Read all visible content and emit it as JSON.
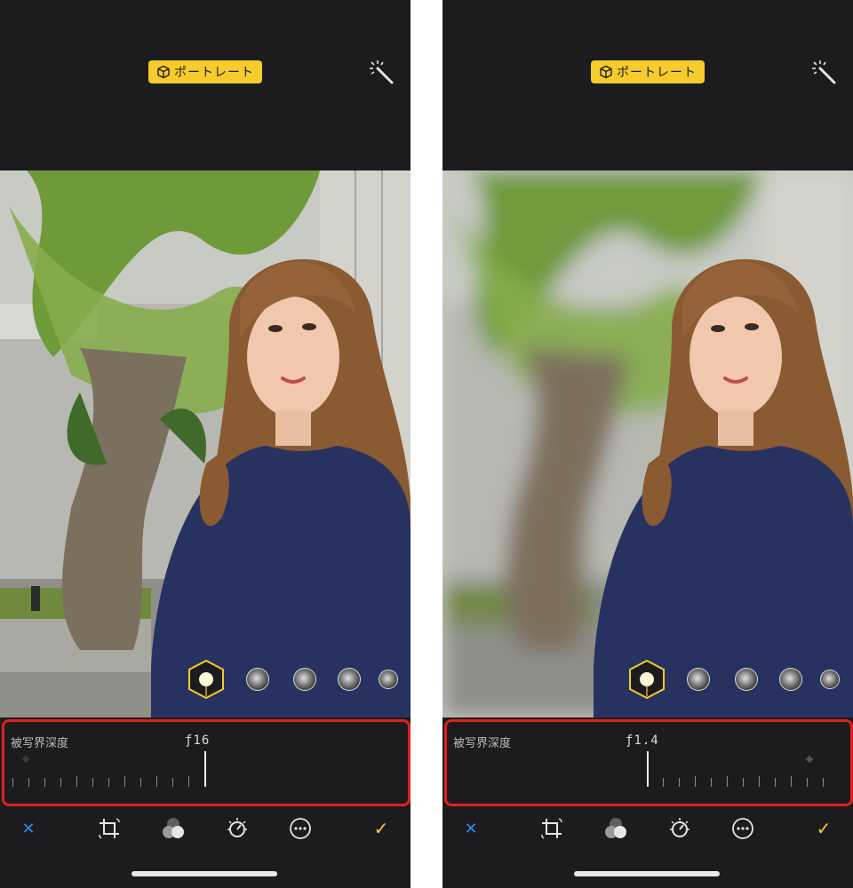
{
  "screens": [
    {
      "id": "left",
      "mode_badge": "ポートレート",
      "depth_label": "被写界深度",
      "f_value": "ƒ16",
      "background": "sharp",
      "slider_fraction": 0.0
    },
    {
      "id": "right",
      "mode_badge": "ポートレート",
      "depth_label": "被写界深度",
      "f_value": "ƒ1.4",
      "background": "blurred",
      "slider_fraction": 1.0
    }
  ],
  "icons": {
    "portrait": "cube-icon",
    "auto_enhance": "magic-wand-icon",
    "cancel": "close-icon",
    "crop": "crop-rotate-icon",
    "filters": "filters-icon",
    "adjust": "adjust-dial-icon",
    "more": "more-icon",
    "done": "checkmark-icon"
  },
  "colors": {
    "accent_yellow": "#f5cc2b",
    "cancel_blue": "#2b8bf2",
    "highlight_red": "#e0201c",
    "panel_bg": "#1c1c1e"
  }
}
